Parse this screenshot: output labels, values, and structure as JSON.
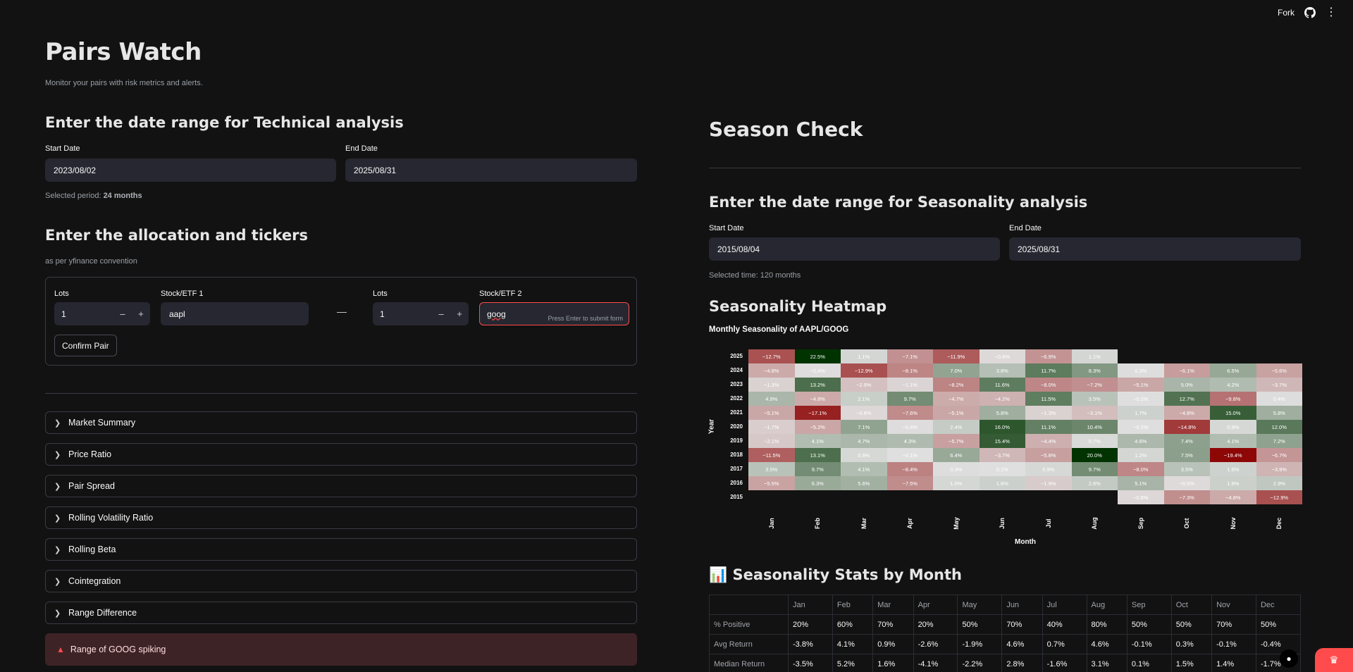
{
  "topbar": {
    "fork_label": "Fork",
    "menu_icon": "more-vert-icon",
    "github_icon": "github-icon"
  },
  "app": {
    "title": "Pairs Watch",
    "subtitle": "Monitor your pairs with risk metrics and alerts."
  },
  "technical": {
    "heading": "Enter the date range for Technical analysis",
    "start_label": "Start Date",
    "start_value": "2023/08/02",
    "end_label": "End Date",
    "end_value": "2025/08/31",
    "period_prefix": "Selected period: ",
    "period_value": "24 months"
  },
  "allocation": {
    "heading": "Enter the allocation and tickers",
    "caption": "as per yfinance convention",
    "lots1_label": "Lots",
    "lots1_value": "1",
    "ticker1_label": "Stock/ETF 1",
    "ticker1_value": "aapl",
    "separator": "—",
    "lots2_label": "Lots",
    "lots2_value": "1",
    "ticker2_label": "Stock/ETF 2",
    "ticker2_value": "goog",
    "submit_hint": "Press Enter to submit form",
    "confirm_label": "Confirm Pair",
    "minus": "–",
    "plus": "+"
  },
  "expanders": [
    "Market Summary",
    "Price Ratio",
    "Pair Spread",
    "Rolling Volatility Ratio",
    "Rolling Beta",
    "Cointegration",
    "Range Difference"
  ],
  "alert": {
    "icon": "siren-icon",
    "text": "Range of GOOG spiking"
  },
  "season": {
    "title": "Season Check",
    "heading": "Enter the date range for Seasonality analysis",
    "start_label": "Start Date",
    "start_value": "2015/08/04",
    "end_label": "End Date",
    "end_value": "2025/08/31",
    "selected_time": "Selected time: 120 months",
    "heatmap_heading": "Seasonality Heatmap",
    "stats_heading": "📊 Seasonality Stats by Month"
  },
  "chart_data": {
    "type": "heatmap",
    "title": "Monthly Seasonality of AAPL/GOOG",
    "xlabel": "Month",
    "ylabel": "Year",
    "x": [
      "Jan",
      "Feb",
      "Mar",
      "Apr",
      "May",
      "Jun",
      "Jul",
      "Aug",
      "Sep",
      "Oct",
      "Nov",
      "Dec"
    ],
    "y": [
      "2025",
      "2024",
      "2023",
      "2022",
      "2021",
      "2020",
      "2019",
      "2018",
      "2017",
      "2016",
      "2015"
    ],
    "values": [
      [
        -12.7,
        22.5,
        1.1,
        -7.1,
        -11.9,
        -0.6,
        -6.9,
        1.1,
        null,
        null,
        null,
        null
      ],
      [
        -4.8,
        -0.4,
        -12.9,
        -8.1,
        7.0,
        3.8,
        11.7,
        8.3,
        0.3,
        -6.1,
        6.5,
        -5.6
      ],
      [
        -1.3,
        13.2,
        -2.9,
        -1.1,
        -8.2,
        11.6,
        -8.0,
        -7.2,
        -5.1,
        5.0,
        4.2,
        -3.7
      ],
      [
        4.9,
        -4.8,
        2.1,
        9.7,
        -4.7,
        -4.2,
        11.5,
        3.5,
        -0.2,
        12.7,
        -9.8,
        0.4
      ],
      [
        -5.1,
        -17.1,
        -0.8,
        -7.6,
        -5.1,
        5.8,
        -1.3,
        -3.1,
        1.7,
        -4.8,
        15.0,
        5.8
      ],
      [
        -1.7,
        -5.2,
        7.1,
        -0.4,
        2.4,
        16.0,
        11.1,
        10.4,
        -0.2,
        -14.8,
        0.9,
        12.0
      ],
      [
        -2.1,
        4.1,
        4.7,
        4.3,
        -5.7,
        15.4,
        -4.4,
        0.7,
        4.6,
        7.4,
        4.1,
        7.2
      ],
      [
        -11.5,
        13.1,
        0.9,
        -0.1,
        6.4,
        -3.7,
        -5.8,
        20.0,
        1.2,
        7.5,
        -19.4,
        -6.7
      ],
      [
        3.5,
        9.7,
        4.1,
        -8.4,
        0.3,
        0.1,
        0.9,
        9.7,
        -8.0,
        3.5,
        1.6,
        -3.9
      ],
      [
        -5.5,
        6.3,
        5.6,
        -7.5,
        1.0,
        1.8,
        -1.9,
        2.6,
        5.1,
        -0.5,
        1.9,
        2.9
      ],
      [
        null,
        null,
        null,
        null,
        null,
        null,
        null,
        null,
        -0.8,
        -7.3,
        -4.8,
        -12.9
      ]
    ],
    "color_scale": {
      "neg": "#8b0000",
      "mid": "#e0e0e0",
      "pos": "#003300"
    }
  },
  "stats_table": {
    "columns": [
      "",
      "Jan",
      "Feb",
      "Mar",
      "Apr",
      "May",
      "Jun",
      "Jul",
      "Aug",
      "Sep",
      "Oct",
      "Nov",
      "Dec"
    ],
    "rows": [
      [
        "% Positive",
        "20%",
        "60%",
        "70%",
        "20%",
        "50%",
        "70%",
        "40%",
        "80%",
        "50%",
        "50%",
        "70%",
        "50%"
      ],
      [
        "Avg Return",
        "-3.8%",
        "4.1%",
        "0.9%",
        "-2.6%",
        "-1.9%",
        "4.6%",
        "0.7%",
        "4.6%",
        "-0.1%",
        "0.3%",
        "-0.1%",
        "-0.4%"
      ],
      [
        "Median Return",
        "-3.5%",
        "5.2%",
        "1.6%",
        "-4.1%",
        "-2.2%",
        "2.8%",
        "-1.6%",
        "3.1%",
        "0.1%",
        "1.5%",
        "1.4%",
        "-1.7%"
      ]
    ]
  }
}
